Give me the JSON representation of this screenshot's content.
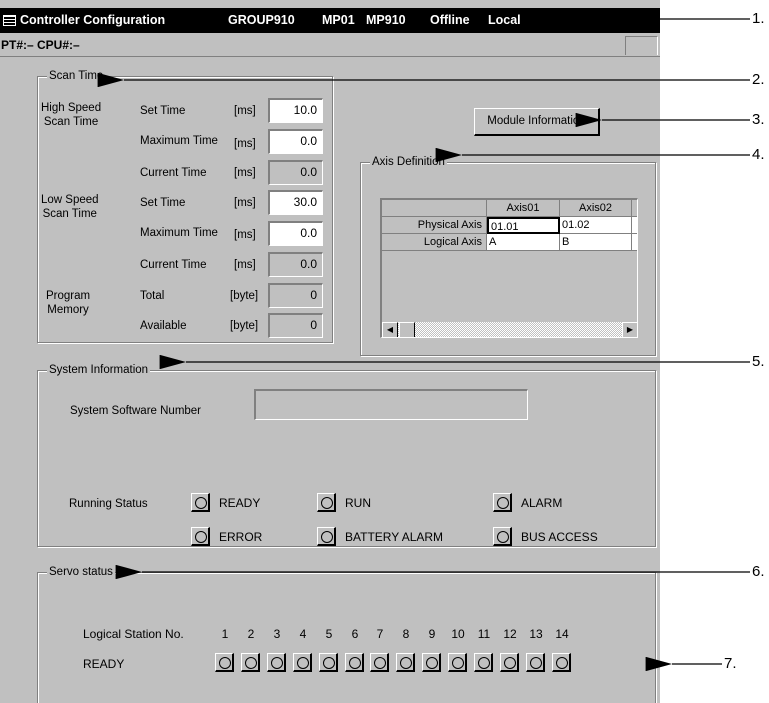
{
  "window": {
    "title": "Controller Configuration",
    "group": "GROUP910",
    "module": "MP01",
    "cpu_model": "MP910",
    "mode": "Offline",
    "connection": "Local",
    "pt_cpu": "PT#:– CPU#:–"
  },
  "scan_time": {
    "legend": "Scan Time",
    "high_speed_label": "High Speed\nScan Time",
    "low_speed_label": "Low Speed\nScan Time",
    "program_memory_label": "Program\nMemory",
    "set_time_label": "Set Time",
    "maximum_time_label": "Maximum Time",
    "current_time_label": "Current Time",
    "total_label": "Total",
    "available_label": "Available",
    "unit_ms": "[ms]",
    "unit_byte": "[byte]",
    "high_set": "10.0",
    "high_max": "0.0",
    "high_current": "0.0",
    "low_set": "30.0",
    "low_max": "0.0",
    "low_current": "0.0",
    "memory_total": "0",
    "memory_available": "0"
  },
  "module_info_button": "Module Information",
  "axis_definition": {
    "legend": "Axis Definition",
    "columns": [
      "Axis01",
      "Axis02"
    ],
    "rows": [
      {
        "label": "Physical Axis",
        "values": [
          "01.01",
          "01.02"
        ]
      },
      {
        "label": "Logical Axis",
        "values": [
          "A",
          "B"
        ]
      }
    ]
  },
  "system_information": {
    "legend": "System Information",
    "software_number_label": "System Software Number",
    "software_number_value": "",
    "running_status_label": "Running Status",
    "status_lamps": [
      "READY",
      "RUN",
      "ALARM",
      "ERROR",
      "BATTERY ALARM",
      "BUS ACCESS"
    ]
  },
  "servo_status": {
    "legend": "Servo status",
    "station_label": "Logical Station No.",
    "ready_label": "READY",
    "stations": [
      "1",
      "2",
      "3",
      "4",
      "5",
      "6",
      "7",
      "8",
      "9",
      "10",
      "11",
      "12",
      "13",
      "14"
    ]
  },
  "callouts": [
    "1.",
    "2.",
    "3.",
    "4.",
    "5.",
    "6.",
    "7."
  ]
}
